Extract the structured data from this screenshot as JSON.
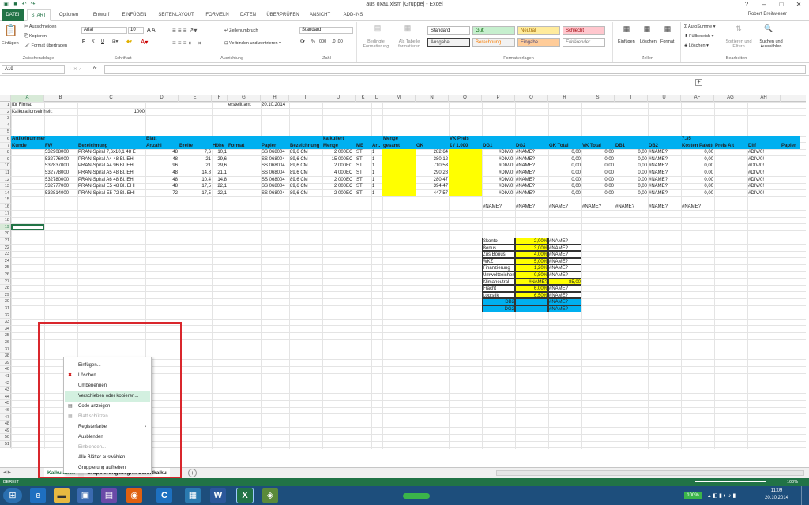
{
  "titlebar": {
    "title": "aus oxa1.xlsm  [Gruppe] - Excel"
  },
  "tabs": [
    "DATEI",
    "START",
    "Optionen",
    "Entwurf",
    "EINFÜGEN",
    "SEITENLAYOUT",
    "FORMELN",
    "DATEN",
    "ÜBERPRÜFEN",
    "ANSICHT",
    "ADD-INS"
  ],
  "user": "Robert Breitwieser",
  "ribbon": {
    "clipboard": {
      "paste": "Einfügen",
      "cut": "Ausschneiden",
      "copy": "Kopieren",
      "format": "Format übertragen",
      "label": "Zwischenablage"
    },
    "font": {
      "name": "Arial",
      "size": "10",
      "label": "Schriftart",
      "bold": "F",
      "italic": "K",
      "underline": "U"
    },
    "alignment": {
      "wrap": "Zeilenumbruch",
      "merge": "Verbinden und zentrieren",
      "label": "Ausrichtung"
    },
    "number": {
      "format": "Standard",
      "label": "Zahl",
      "percent": "%",
      "thousands": "000"
    },
    "cond": {
      "cond_format": "Bedingte Formatierung",
      "as_table": "Als Tabelle formatieren"
    },
    "styles": {
      "label": "Formatvorlagen",
      "items": [
        {
          "name": "Standard",
          "bg": "#ffffff",
          "fg": "#222222"
        },
        {
          "name": "Gut",
          "bg": "#c6efce",
          "fg": "#006100"
        },
        {
          "name": "Neutral",
          "bg": "#ffeb9c",
          "fg": "#9c6500"
        },
        {
          "name": "Schlecht",
          "bg": "#ffc7ce",
          "fg": "#9c0006"
        },
        {
          "name": "Ausgabe",
          "bg": "#f2f2f2",
          "fg": "#3f3f3f"
        },
        {
          "name": "Berechnung",
          "bg": "#f2f2f2",
          "fg": "#fa7d00"
        },
        {
          "name": "Eingabe",
          "bg": "#ffcc99",
          "fg": "#3f3f76"
        },
        {
          "name": "Erklärender ...",
          "bg": "#ffffff",
          "fg": "#7f7f7f"
        }
      ]
    },
    "cells": {
      "insert": "Einfügen",
      "delete": "Löschen",
      "format": "Format",
      "label": "Zellen"
    },
    "editing": {
      "autosum": "AutoSumme",
      "fill": "Füllbereich",
      "clear": "Löschen",
      "sort": "Sortieren und Filtern",
      "find": "Suchen und Auswählen",
      "label": "Bearbeiten"
    }
  },
  "formula_bar": {
    "name_box": "A19",
    "fx": "fx",
    "content": ""
  },
  "columns": [
    "A",
    "B",
    "C",
    "D",
    "E",
    "F",
    "G",
    "H",
    "I",
    "J",
    "K",
    "L",
    "M",
    "N",
    "O",
    "P",
    "Q",
    "R",
    "S",
    "T",
    "U",
    "AF",
    "AG",
    "AH"
  ],
  "header_rows": {
    "r1": {
      "label": "für Firma:",
      "g_label": "erstellt am:",
      "h_value": "20.10.2014"
    },
    "r2": {
      "label": "Kalkulationseinheit:",
      "c_value": "1000"
    },
    "r6": [
      "Artikelnummer",
      "",
      "",
      "Blatt",
      "",
      "",
      "",
      "",
      "",
      "kalkuliert",
      "",
      "",
      "Menge",
      "",
      "VK Preis",
      "",
      "",
      "",
      "",
      "",
      "",
      "7,35",
      "",
      ""
    ],
    "r7": [
      "Kunde",
      "FW",
      "Bezeichnung",
      "Anzahl",
      "Breite",
      "Höhe",
      "Format",
      "Papier",
      "Bezeichnung",
      "Menge",
      "ME",
      "Art.",
      "gesamt",
      "GK",
      "€ / 1.000",
      "DG1",
      "DG2",
      "GK Total",
      "VK Total",
      "DB1",
      "DB2",
      "Kosten Palette",
      "Preis Alt",
      "Diff",
      "Papier"
    ]
  },
  "data_rows": [
    [
      "",
      "532908000",
      "PRAN-Spiral 7,6x10,1 48 E",
      "48",
      "7,6",
      "10,1",
      "",
      "SS 068004",
      "89,6 CM",
      "EC",
      "2 000",
      "ST",
      "1",
      "",
      "282,64",
      "",
      "#DIV/0!",
      "#NAME?",
      "0,00",
      "0,00",
      "0,00",
      "#NAME?",
      "0,00",
      "",
      "#DIV/0!"
    ],
    [
      "",
      "532776000",
      "PRAN-Spiral A4 48 Bl. EHI",
      "48",
      "21",
      "29,6",
      "",
      "SS 068004",
      "89,6 CM",
      "EC",
      "15 000",
      "ST",
      "1",
      "",
      "380,12",
      "",
      "#DIV/0!",
      "#NAME?",
      "0,00",
      "0,00",
      "0,00",
      "#NAME?",
      "0,00",
      "",
      "#DIV/0!"
    ],
    [
      "",
      "532837000",
      "PRAN-Spiral A4 96 Bl. EHI",
      "96",
      "21",
      "29,6",
      "",
      "SS 068004",
      "89,6 CM",
      "EC",
      "2 000",
      "ST",
      "1",
      "",
      "710,53",
      "",
      "#DIV/0!",
      "#NAME?",
      "0,00",
      "0,00",
      "0,00",
      "#NAME?",
      "0,00",
      "",
      "#DIV/0!"
    ],
    [
      "",
      "532778000",
      "PRAN-Spiral A5 48 Bl. EHI",
      "48",
      "14,8",
      "21,1",
      "",
      "SS 068004",
      "89,6 CM",
      "EC",
      "4 000",
      "ST",
      "1",
      "",
      "290,28",
      "",
      "#DIV/0!",
      "#NAME?",
      "0,00",
      "0,00",
      "0,00",
      "#NAME?",
      "0,00",
      "",
      "#DIV/0!"
    ],
    [
      "",
      "532780000",
      "PRAN-Spiral A6 48 Bl. EHI",
      "48",
      "10,4",
      "14,8",
      "",
      "SS 068004",
      "89,6 CM",
      "EC",
      "2 000",
      "ST",
      "1",
      "",
      "280,47",
      "",
      "#DIV/0!",
      "#NAME?",
      "0,00",
      "0,00",
      "0,00",
      "#NAME?",
      "0,00",
      "",
      "#DIV/0!"
    ],
    [
      "",
      "532777000",
      "PRAN-Spiral E5 48 Bl. EHI",
      "48",
      "17,5",
      "22,1",
      "",
      "SS 068004",
      "89,6 CM",
      "EC",
      "2 000",
      "ST",
      "1",
      "",
      "394,47",
      "",
      "#DIV/0!",
      "#NAME?",
      "0,00",
      "0,00",
      "0,00",
      "#NAME?",
      "0,00",
      "",
      "#DIV/0!"
    ],
    [
      "",
      "532814000",
      "PRAN-Spiral E5 72 Bl. EHI",
      "72",
      "17,5",
      "22,1",
      "",
      "SS 068004",
      "89,6 CM",
      "EC",
      "2 000",
      "ST",
      "1",
      "",
      "447,57",
      "",
      "#DIV/0!",
      "#NAME?",
      "0,00",
      "0,00",
      "0,00",
      "#NAME?",
      "0,00",
      "",
      "#DIV/0!"
    ]
  ],
  "row16": [
    "#NAME?",
    "#NAME?",
    "#NAME?",
    "#NAME?",
    "#NAME?",
    "#NAME?",
    "#NAME?"
  ],
  "calc_table": [
    {
      "label": "Skonto",
      "pct": "2,00%",
      "val": "#NAME?"
    },
    {
      "label": "Bonus",
      "pct": "3,00%",
      "val": "#NAME?"
    },
    {
      "label": "Zus Bonus",
      "pct": "4,00%",
      "val": "#NAME?"
    },
    {
      "label": "WKZ",
      "pct": "5,00%",
      "val": "#NAME?"
    },
    {
      "label": "Finanzierung",
      "pct": "1,20%",
      "val": "#NAME?"
    },
    {
      "label": "Umweltzeichen",
      "pct": "0,80%",
      "val": "#NAME?"
    },
    {
      "label": "Klimaneutral",
      "pct": "#NAME?",
      "val": "85,00"
    },
    {
      "label": "Fracht",
      "pct": "6,00%",
      "val": "#NAME?"
    },
    {
      "label": "Logistik",
      "pct": "6,50%",
      "val": "#NAME?"
    },
    {
      "label": "DB2",
      "pct": "",
      "val": "#NAME?"
    },
    {
      "label": "DG2",
      "pct": "",
      "val": "#NAME?"
    }
  ],
  "context_menu": [
    {
      "label": "Einfügen...",
      "disabled": false
    },
    {
      "label": "Löschen",
      "disabled": false
    },
    {
      "label": "Umbenennen",
      "disabled": false
    },
    {
      "label": "Verschieben oder kopieren...",
      "disabled": false,
      "highlight": true
    },
    {
      "label": "Code anzeigen",
      "disabled": false
    },
    {
      "label": "Blatt schützen...",
      "disabled": true
    },
    {
      "label": "Registerfarbe",
      "disabled": false,
      "submenu": true
    },
    {
      "label": "Ausblenden",
      "disabled": false
    },
    {
      "label": "Einblenden...",
      "disabled": true
    },
    {
      "label": "Alle Blätter auswählen",
      "disabled": false
    },
    {
      "label": "Gruppierung aufheben",
      "disabled": false
    }
  ],
  "sheet_tabs": [
    "Kalkulation",
    "Gruppierungsbegriff Sofortkalku"
  ],
  "status": {
    "mode": "BEREIT",
    "zoom": "100%"
  },
  "taskbar": {
    "time": "11:09",
    "date": "20.10.2014"
  },
  "colors": {
    "accent": "#217346",
    "header_blue": "#00b0f0",
    "yellow": "#ffff00",
    "red_outline": "#d9262c"
  }
}
